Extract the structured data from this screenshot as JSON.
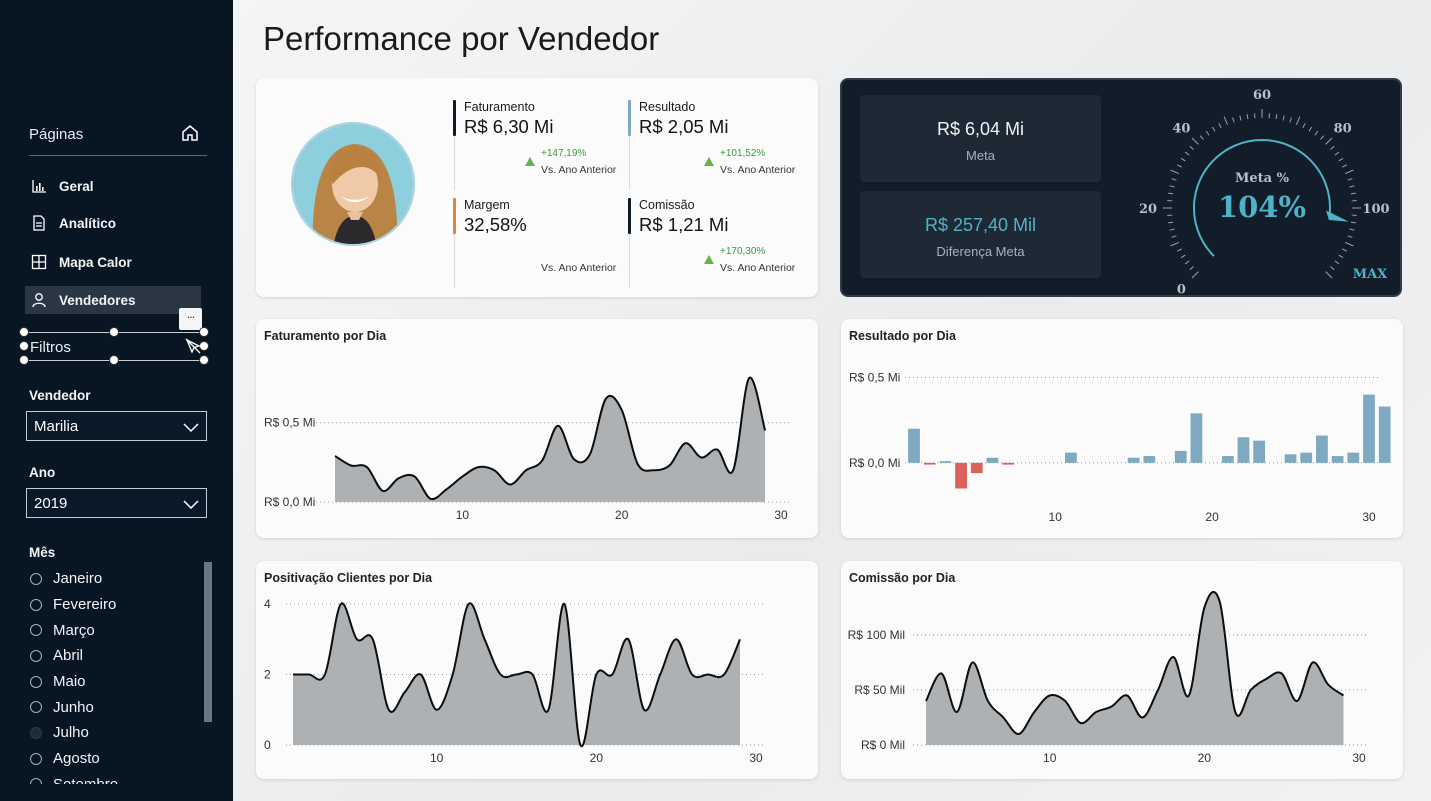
{
  "page": {
    "title": "Performance por Vendedor"
  },
  "sidebar": {
    "pages_label": "Páginas",
    "nav": [
      {
        "label": "Geral",
        "icon": "bar-chart-icon"
      },
      {
        "label": "Analítico",
        "icon": "document-icon"
      },
      {
        "label": "Mapa Calor",
        "icon": "grid-icon"
      },
      {
        "label": "Vendedores",
        "icon": "user-icon",
        "active": true
      }
    ],
    "filters_label": "Filtros",
    "more_label": "···",
    "vendedor": {
      "label": "Vendedor",
      "value": "Marilia"
    },
    "ano": {
      "label": "Ano",
      "value": "2019"
    },
    "mes": {
      "label": "Mês",
      "options": [
        "Janeiro",
        "Fevereiro",
        "Março",
        "Abril",
        "Maio",
        "Junho",
        "Julho",
        "Agosto",
        "Setembro"
      ],
      "selected": "Julho"
    }
  },
  "kpis": {
    "faturamento": {
      "name": "Faturamento",
      "value": "R$ 6,30 Mi",
      "delta": "+147,19%",
      "vs": "Vs. Ano Anterior",
      "color": "#0d1a28"
    },
    "resultado": {
      "name": "Resultado",
      "value": "R$ 2,05 Mi",
      "delta": "+101,52%",
      "vs": "Vs. Ano Anterior",
      "color": "#7fa9c1"
    },
    "margem": {
      "name": "Margem",
      "value": "32,58%",
      "delta": "",
      "vs": "Vs. Ano Anterior",
      "color": "#d98440"
    },
    "comissao": {
      "name": "Comissão",
      "value": "R$ 1,21 Mi",
      "delta": "+170,30%",
      "vs": "Vs. Ano Anterior",
      "color": "#0d1a28"
    }
  },
  "meta": {
    "meta_value": "R$ 6,04 Mi",
    "meta_label": "Meta",
    "diff_value": "R$ 257,40 Mil",
    "diff_label": "Diferença Meta",
    "gauge_title": "Meta %",
    "gauge_value": "104%",
    "gauge_ticks": [
      "0",
      "20",
      "40",
      "60",
      "80",
      "100"
    ],
    "gauge_max_label": "MAX",
    "gauge_percent": 104,
    "accent": "#4fb3c8"
  },
  "chart_data": [
    {
      "type": "area",
      "title": "Faturamento por Dia",
      "x": [
        2,
        3,
        4,
        5,
        6,
        7,
        8,
        9,
        10,
        11,
        12,
        13,
        14,
        15,
        16,
        17,
        18,
        19,
        20,
        21,
        22,
        23,
        24,
        25,
        26,
        27,
        28,
        29
      ],
      "values": [
        0.29,
        0.23,
        0.22,
        0.07,
        0.15,
        0.16,
        0.02,
        0.08,
        0.16,
        0.22,
        0.2,
        0.11,
        0.2,
        0.26,
        0.48,
        0.27,
        0.3,
        0.65,
        0.58,
        0.24,
        0.2,
        0.23,
        0.37,
        0.28,
        0.33,
        0.2,
        0.78,
        0.45
      ],
      "y_ticks": [
        "R$ 0,0 Mi",
        "R$ 0,5 Mi"
      ],
      "y_tick_values": [
        0,
        0.5
      ],
      "x_ticks": [
        "10",
        "20",
        "30"
      ],
      "ylim": [
        0,
        0.85
      ]
    },
    {
      "type": "bar",
      "title": "Resultado por Dia",
      "x": [
        1,
        2,
        3,
        4,
        5,
        6,
        7,
        8,
        9,
        10,
        11,
        12,
        13,
        14,
        15,
        16,
        17,
        18,
        19,
        20,
        21,
        22,
        23,
        24,
        25,
        26,
        27,
        28,
        29,
        30
      ],
      "values": [
        0.2,
        -0.01,
        0.01,
        -0.15,
        -0.06,
        0.03,
        -0.01,
        0,
        0,
        0,
        0.06,
        0,
        0,
        0,
        0.03,
        0.04,
        0,
        0.07,
        0.29,
        0,
        0.04,
        0.15,
        0.13,
        0,
        0.05,
        0.06,
        0.16,
        0.04,
        0.06,
        0.4,
        0.33
      ],
      "colors": {
        "positive": "#7fa9c1",
        "negative": "#d9625d"
      },
      "y_ticks": [
        "R$ 0,0 Mi",
        "R$ 0,5 Mi"
      ],
      "y_tick_values": [
        0,
        0.5
      ],
      "x_ticks": [
        "10",
        "20",
        "30"
      ],
      "ylim": [
        -0.2,
        0.55
      ]
    },
    {
      "type": "area",
      "title": "Positivação Clientes por Dia",
      "x": [
        1,
        2,
        3,
        4,
        5,
        6,
        7,
        8,
        9,
        10,
        11,
        12,
        13,
        14,
        15,
        16,
        17,
        18,
        19,
        20,
        21,
        22,
        23,
        24,
        25,
        26,
        27,
        28,
        29
      ],
      "values": [
        2,
        2,
        2,
        4,
        3,
        3,
        1,
        1.5,
        2,
        1,
        2,
        4,
        3,
        2,
        2,
        2,
        1,
        4,
        0,
        2,
        2,
        3,
        1,
        2,
        3,
        2,
        2,
        2,
        3
      ],
      "y_ticks": [
        "0",
        "2",
        "4"
      ],
      "y_tick_values": [
        0,
        2,
        4
      ],
      "x_ticks": [
        "10",
        "20",
        "30"
      ],
      "ylim": [
        0,
        4.2
      ]
    },
    {
      "type": "area",
      "title": "Comissão por Dia",
      "x": [
        2,
        3,
        4,
        5,
        6,
        7,
        8,
        9,
        10,
        11,
        12,
        13,
        14,
        15,
        16,
        17,
        18,
        19,
        20,
        21,
        22,
        23,
        24,
        25,
        26,
        27,
        28,
        29
      ],
      "values": [
        40,
        65,
        30,
        75,
        40,
        25,
        10,
        30,
        45,
        40,
        20,
        30,
        35,
        45,
        25,
        50,
        80,
        45,
        125,
        130,
        30,
        50,
        60,
        65,
        40,
        75,
        55,
        45
      ],
      "y_ticks": [
        "R$ 0 Mil",
        "R$ 50 Mil",
        "R$ 100 Mil"
      ],
      "y_tick_values": [
        0,
        50,
        100
      ],
      "x_ticks": [
        "10",
        "20",
        "30"
      ],
      "ylim": [
        0,
        140
      ]
    }
  ]
}
